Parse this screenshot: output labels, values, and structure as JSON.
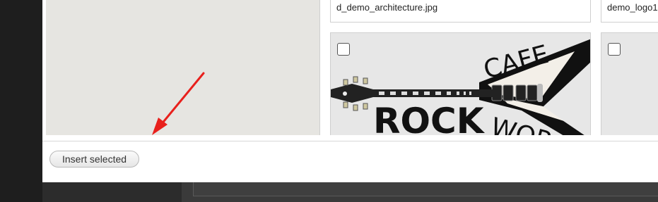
{
  "images": [
    {
      "caption": "d_demo_architecture.jpg"
    },
    {
      "caption": "demo_logo1"
    }
  ],
  "logo": {
    "line1": "CAFE",
    "line2": "ROCK",
    "line3": "WOR"
  },
  "footer": {
    "insert_label": "Insert selected"
  },
  "colors": {
    "annotation_arrow": "#e8201c",
    "sidebar_bg": "#e6e5e1",
    "thumb_bg": "#e7e7e7"
  }
}
